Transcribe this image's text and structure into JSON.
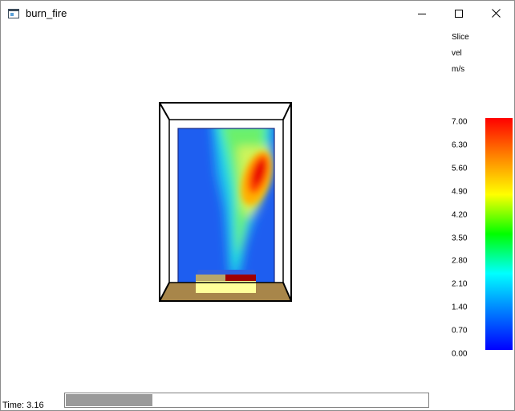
{
  "window": {
    "title": "burn_fire",
    "controls": [
      "minimize",
      "maximize",
      "close"
    ]
  },
  "legend": {
    "slice_label": "Slice",
    "quantity": "vel",
    "unit": "m/s",
    "ticks": [
      "7.00",
      "6.30",
      "5.60",
      "4.90",
      "4.20",
      "3.50",
      "2.80",
      "2.10",
      "1.40",
      "0.70",
      "0.00"
    ],
    "min": 0.0,
    "max": 7.0,
    "colors": [
      "#ff0000",
      "#ff8000",
      "#ffff00",
      "#00ff00",
      "#00ffff",
      "#0080ff",
      "#0000ff"
    ]
  },
  "scene": {
    "floor_color": "#a8864a",
    "burner_color": "#ffff99",
    "burner_hot_color": "#a00000",
    "slice_background": "#1e5ef0"
  },
  "timebar": {
    "label": "Time: 3.16",
    "progress": 0.24
  }
}
